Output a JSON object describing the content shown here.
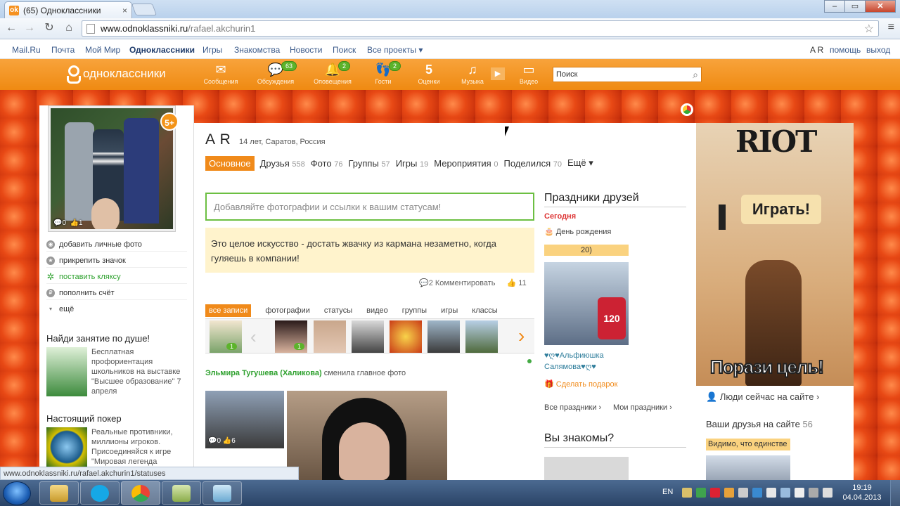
{
  "browser": {
    "tab_title": "(65) Одноклассники",
    "tab_close": "×",
    "url_domain": "www.odnoklassniki.ru",
    "url_path": "/rafael.akchurin1",
    "status_url": "www.odnoklassniki.ru/rafael.akchurin1/statuses",
    "win_min": "–",
    "win_max": "▭",
    "win_close": "✕"
  },
  "portal": {
    "links": [
      "Mail.Ru",
      "Почта",
      "Мой Мир",
      "Одноклассники",
      "Игры",
      "Знакомства",
      "Новости",
      "Поиск",
      "Все проекты ▾"
    ],
    "user": "A R",
    "help": "помощь",
    "exit": "выход"
  },
  "header": {
    "logo": "одноклассники",
    "items": [
      {
        "label": "Сообщения",
        "icon": "envelope-icon",
        "glyph": "✉",
        "count": ""
      },
      {
        "label": "Обсуждения",
        "icon": "discussions-icon",
        "glyph": "💬",
        "count": "63"
      },
      {
        "label": "Оповещения",
        "icon": "bell-icon",
        "glyph": "🔔",
        "count": "2"
      },
      {
        "label": "Гости",
        "icon": "footprints-icon",
        "glyph": "👣",
        "count": "2"
      },
      {
        "label": "Оценки",
        "icon": "ratings-icon",
        "glyph": "5",
        "count": ""
      },
      {
        "label": "Музыка",
        "icon": "music-icon",
        "glyph": "♫",
        "count": ""
      },
      {
        "label": "Видео",
        "icon": "video-icon",
        "glyph": "▭",
        "count": ""
      }
    ],
    "search_placeholder": "Поиск"
  },
  "left": {
    "avatar_comments": "0",
    "avatar_likes": "1",
    "badge": "5+",
    "menu": [
      "добавить личные фото",
      "прикрепить значок",
      "поставить кляксу",
      "пополнить счёт",
      "ещё"
    ],
    "promo1_title": "Найди занятие по душе!",
    "promo1_text": "Бесплатная профориентация школьников на выставке \"Высшее образование\" 7 апреля",
    "promo2_title": "Настоящий покер",
    "promo2_text": "Реальные противники, миллионы игроков. Присоединяйся к игре \"Мировая легенда"
  },
  "profile": {
    "name": "A R",
    "info": "14 лет, Саратов, Россия",
    "tabs": [
      {
        "label": "Основное",
        "count": ""
      },
      {
        "label": "Друзья",
        "count": "558"
      },
      {
        "label": "Фото",
        "count": "76"
      },
      {
        "label": "Группы",
        "count": "57"
      },
      {
        "label": "Игры",
        "count": "19"
      },
      {
        "label": "Мероприятия",
        "count": "0"
      },
      {
        "label": "Поделился",
        "count": "70"
      },
      {
        "label": "Ещё ▾",
        "count": ""
      }
    ],
    "status_placeholder": "Добавляйте фотографии и ссылки к вашим статусам!",
    "status_text": "Это целое искусство - достать жвачку из кармана незаметно, когда гуляешь в компании!",
    "comment_action": "2 Комментировать",
    "likes": "11",
    "feed_tabs": [
      "все записи",
      "фотографии",
      "статусы",
      "видео",
      "группы",
      "игры",
      "классы"
    ],
    "feed_user": "Эльмира Тугушева (Халикова)",
    "feed_action": "сменила главное фото",
    "pic1_comments": "0",
    "pic1_likes": "6",
    "strip_badge1": "1",
    "strip_badge2": "1"
  },
  "holidays": {
    "title": "Праздники друзей",
    "today": "Сегодня",
    "type": "День рождения",
    "age": "20)",
    "pic_text": "120",
    "friend": "♥ღ♥Альфиюшка Салямова♥ღ♥",
    "gift": "Сделать подарок",
    "all": "Все праздники ›",
    "mine": "Мои праздники ›",
    "know_title": "Вы знакомы?"
  },
  "ad": {
    "logo": "RIOT",
    "play": "Играть!",
    "slogan": "Порази цель!",
    "online_now": "Люди сейчас на сайте ›",
    "friends_online": "Ваши друзья на сайте",
    "friends_count": "56",
    "seen": "Видимо, что единстве"
  },
  "taskbar": {
    "lang": "EN",
    "time": "19:19",
    "date": "04.04.2013"
  }
}
